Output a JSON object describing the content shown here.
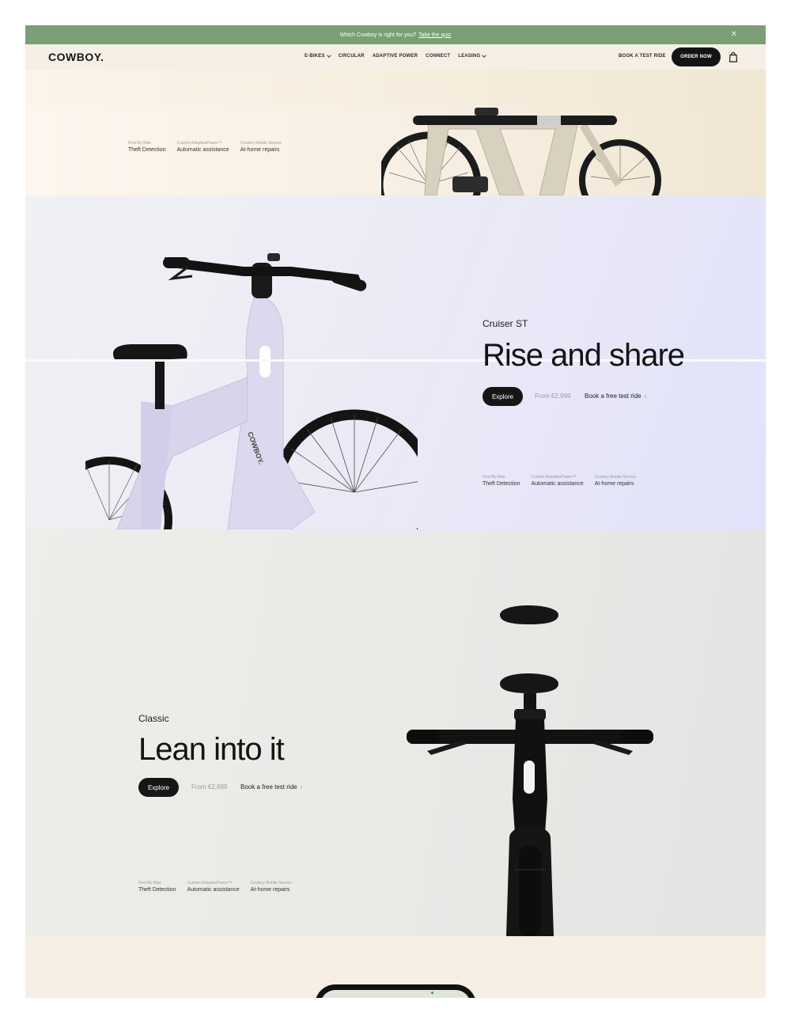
{
  "announcement": {
    "text": "Which Cowboy is right for you?",
    "link": "Take the quiz",
    "close_icon": "close-icon"
  },
  "header": {
    "logo": "COWBOY.",
    "nav": [
      {
        "label": "E-BIKES",
        "has_dropdown": true
      },
      {
        "label": "CIRCULAR",
        "has_dropdown": false
      },
      {
        "label": "ADAPTIVE POWER",
        "has_dropdown": false
      },
      {
        "label": "CONNECT",
        "has_dropdown": false
      },
      {
        "label": "LEASING",
        "has_dropdown": true
      }
    ],
    "test_ride": "BOOK A TEST RIDE",
    "order_now": "ORDER NOW",
    "cart_icon": "shopping-bag-icon"
  },
  "hero_top": {
    "features": [
      {
        "small": "Find My Bike",
        "big": "Theft Detection"
      },
      {
        "small": "Custom AdaptivePower™",
        "big": "Automatic assistance"
      },
      {
        "small": "Cowboy Mobile Service",
        "big": "At-home repairs"
      }
    ]
  },
  "cruiser": {
    "category": "Cruiser ST",
    "headline": "Rise and share",
    "explore": "Explore",
    "price": "From €2,999",
    "book": "Book a free test ride",
    "features": [
      {
        "small": "Find My Bike",
        "big": "Theft Detection"
      },
      {
        "small": "Custom AdaptivePower™",
        "big": "Automatic assistance"
      },
      {
        "small": "Cowboy Mobile Service",
        "big": "At-home repairs"
      }
    ]
  },
  "classic": {
    "category": "Classic",
    "headline": "Lean into it",
    "explore": "Explore",
    "price": "From €2,699",
    "book": "Book a free test ride",
    "features": [
      {
        "small": "Find My Bike",
        "big": "Theft Detection"
      },
      {
        "small": "Custom AdaptivePower™",
        "big": "Automatic assistance"
      },
      {
        "small": "Cowboy Mobile Service",
        "big": "At-home repairs"
      }
    ]
  },
  "colors": {
    "announcement_bg": "#7a9f74",
    "button_dark": "#141414",
    "cruiser_frame": "#dcd8ee",
    "classic_frame": "#1a1a1a"
  }
}
